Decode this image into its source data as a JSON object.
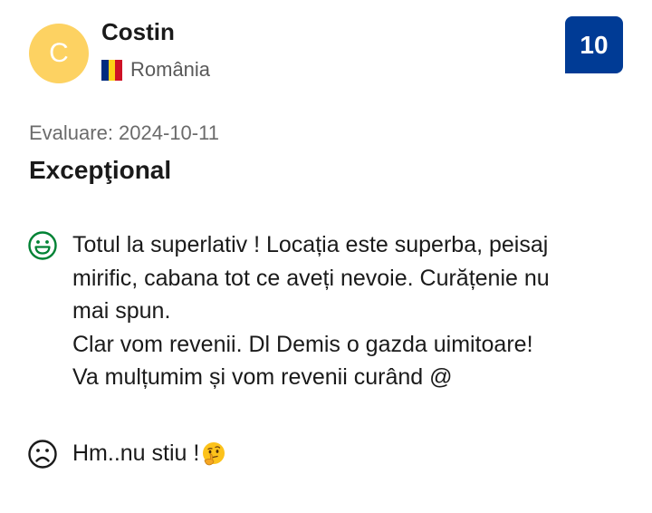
{
  "reviewer": {
    "avatar_initial": "C",
    "name": "Costin",
    "country": "România"
  },
  "score": "10",
  "review": {
    "date_text": "Evaluare: 2024-10-11",
    "title": "Excepţional",
    "positive_lines": [
      "Totul la superlativ ! Locația este superba, peisaj",
      "mirific, cabana tot ce aveți nevoie. Curățenie nu",
      "mai spun.",
      "Clar vom revenii. Dl Demis o gazda uimitoare!",
      "Va mulțumim și vom revenii curând @"
    ],
    "negative_text": "Hm..nu stiu !"
  },
  "icons": {
    "positive": "smiley-face-icon",
    "negative": "frown-face-icon",
    "emoji": "thinking-face-emoji"
  },
  "colors": {
    "avatar_bg": "#fdd262",
    "score_bg": "#003b95",
    "positive_icon": "#008234",
    "negative_icon": "#1a1a1a",
    "flag_blue": "#002b7f",
    "flag_yellow": "#fcd116",
    "flag_red": "#ce1126"
  }
}
